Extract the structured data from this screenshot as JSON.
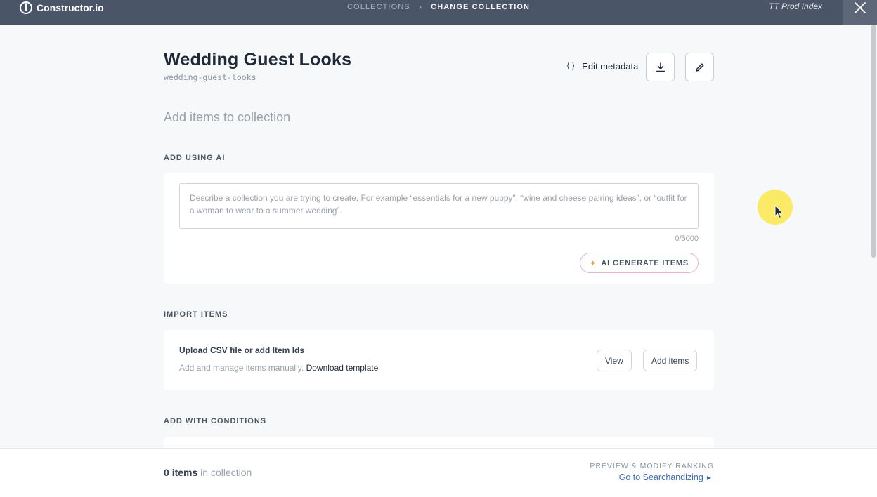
{
  "topbar": {
    "brand": "Constructor.io",
    "breadcrumb": [
      "COLLECTIONS",
      "CHANGE COLLECTION"
    ],
    "index_name": "TT Prod Index"
  },
  "collection": {
    "title": "Wedding Guest Looks",
    "slug": "wedding-guest-looks",
    "edit_metadata_label": "Edit metadata"
  },
  "add_heading": "Add items to collection",
  "ai_section": {
    "label": "ADD USING AI",
    "placeholder": "Describe a collection you are trying to create. For example “essentials for a new puppy”, “wine and cheese pairing ideas”, or “outfit for a woman to wear to a summer wedding”.",
    "char_count": "0/5000",
    "button_label": "AI GENERATE ITEMS"
  },
  "import_section": {
    "label": "IMPORT ITEMS",
    "title": "Upload CSV file or add Item Ids",
    "subtitle": "Add and manage items manually.",
    "download_link": "Download template",
    "view_button": "View",
    "add_button": "Add items"
  },
  "conditions_section": {
    "label": "ADD WITH CONDITIONS"
  },
  "footer": {
    "count": "0",
    "count_unit": "items",
    "count_suffix": "in collection",
    "preview_label": "PREVIEW & MODIFY RANKING",
    "goto_link": "Go to Searchandizing"
  },
  "colors": {
    "topbar_bg": "#4a5568",
    "link": "#3b6fb6",
    "ai_button_border": "#e6b8c8"
  }
}
